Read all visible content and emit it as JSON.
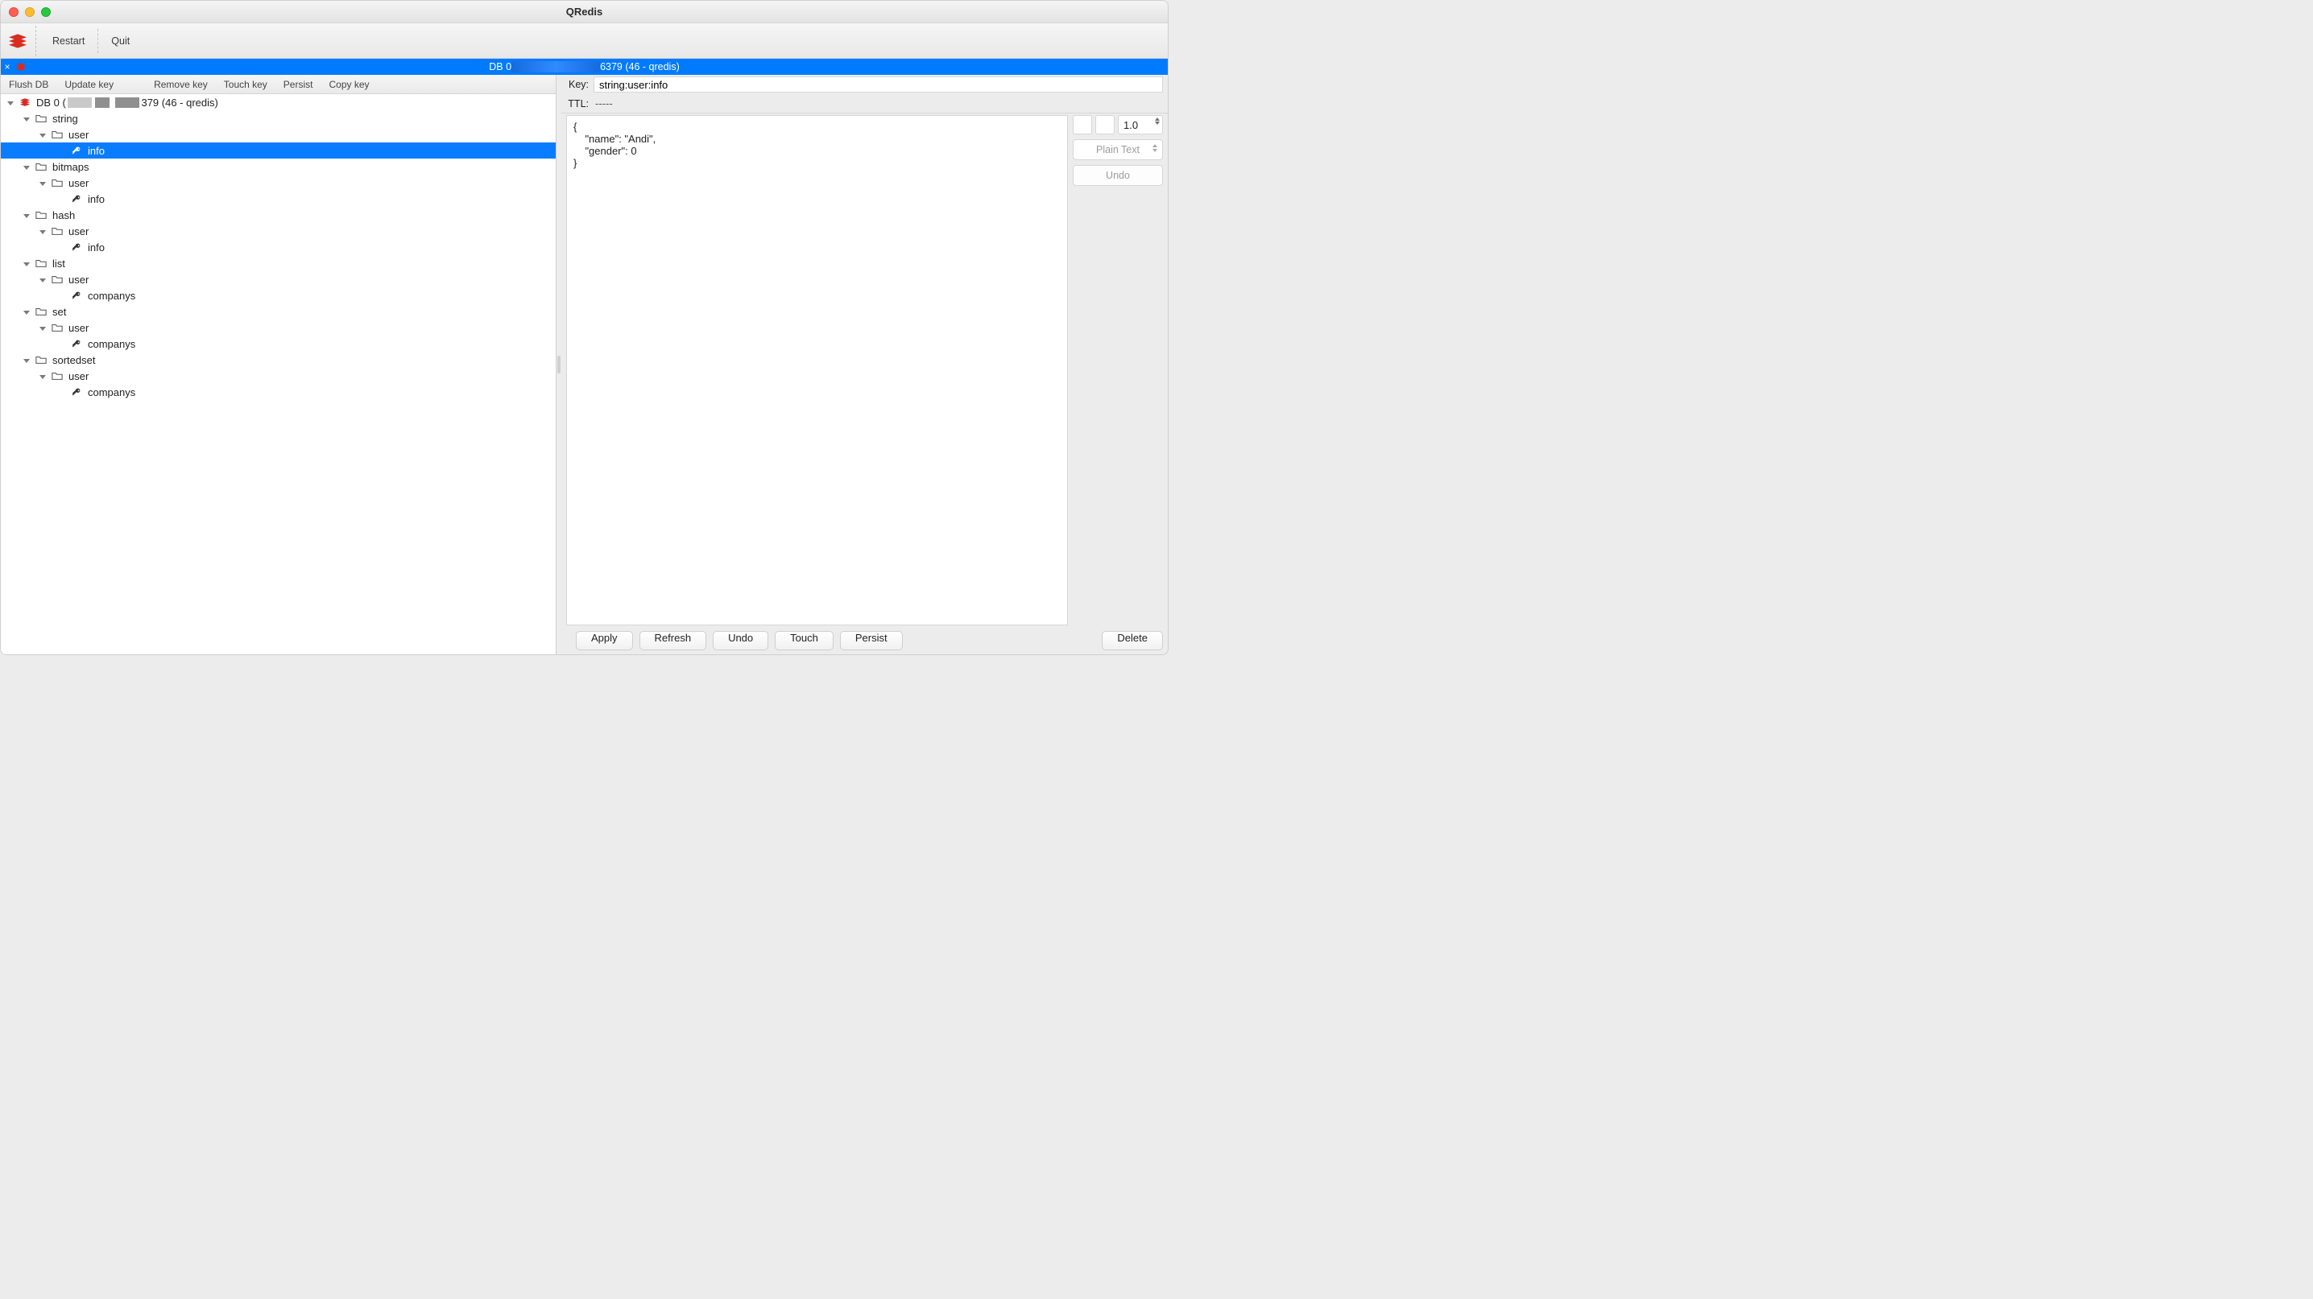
{
  "window": {
    "title": "QRedis"
  },
  "menubar": {
    "restart": "Restart",
    "quit": "Quit"
  },
  "tab": {
    "prefix": "DB 0 ",
    "suffix": "6379 (46 - qredis)"
  },
  "left_toolbar": {
    "flush_db": "Flush DB",
    "update_key": "Update key",
    "remove_key": "Remove key",
    "touch_key": "Touch key",
    "persist": "Persist",
    "copy_key": "Copy key"
  },
  "tree": {
    "db_prefix": "DB 0 (",
    "db_suffix": "379 (46 - qredis)",
    "items": [
      {
        "name": "string",
        "children": [
          {
            "name": "user",
            "children": [
              {
                "name": "info",
                "type": "key",
                "selected": true
              }
            ]
          }
        ]
      },
      {
        "name": "bitmaps",
        "children": [
          {
            "name": "user",
            "children": [
              {
                "name": "info",
                "type": "key"
              }
            ]
          }
        ]
      },
      {
        "name": "hash",
        "children": [
          {
            "name": "user",
            "children": [
              {
                "name": "info",
                "type": "key"
              }
            ]
          }
        ]
      },
      {
        "name": "list",
        "children": [
          {
            "name": "user",
            "children": [
              {
                "name": "companys",
                "type": "key"
              }
            ]
          }
        ]
      },
      {
        "name": "set",
        "children": [
          {
            "name": "user",
            "children": [
              {
                "name": "companys",
                "type": "key"
              }
            ]
          }
        ]
      },
      {
        "name": "sortedset",
        "children": [
          {
            "name": "user",
            "children": [
              {
                "name": "companys",
                "type": "key"
              }
            ]
          }
        ]
      }
    ]
  },
  "details": {
    "key_label": "Key:",
    "key_value": "string:user:info",
    "ttl_label": "TTL:",
    "ttl_value": "-----",
    "value_text": "{\n    \"name\": \"Andi\",\n    \"gender\": 0\n}",
    "font_size": "1.0",
    "format": "Plain Text",
    "undo_side": "Undo"
  },
  "footer": {
    "apply": "Apply",
    "refresh": "Refresh",
    "undo": "Undo",
    "touch": "Touch",
    "persist": "Persist",
    "delete": "Delete"
  }
}
